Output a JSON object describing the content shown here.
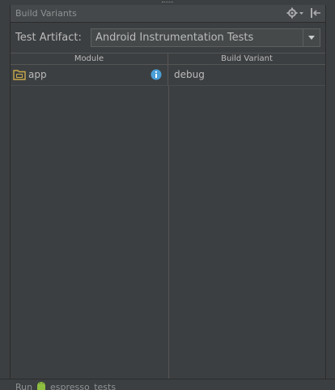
{
  "panel": {
    "title": "Build Variants"
  },
  "test_artifact": {
    "label": "Test Artifact:",
    "selected": "Android Instrumentation Tests"
  },
  "table": {
    "columns": [
      "Module",
      "Build Variant"
    ],
    "rows": [
      {
        "module": "app",
        "build_variant": "debug"
      }
    ]
  },
  "status_bar": {
    "run_label": "Run",
    "config_name": "espresso_tests"
  },
  "colors": {
    "background": "#3c3f41",
    "header": "#45484a",
    "text": "#bbbbbb",
    "info_icon": "#4a9fd8",
    "folder_icon": "#c9a84b",
    "android_icon": "#8dbe3f"
  },
  "icons": [
    "gear-icon",
    "hide-panel-icon",
    "dropdown-arrow-icon",
    "module-folder-icon",
    "info-icon",
    "android-icon"
  ]
}
